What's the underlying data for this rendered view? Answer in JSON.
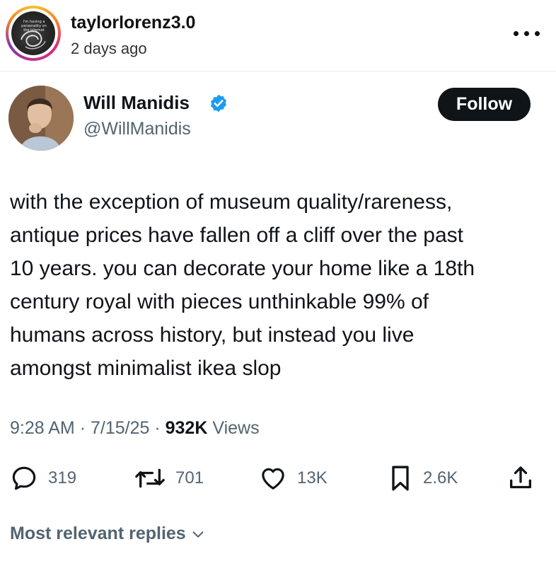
{
  "post_header": {
    "username": "taylorlorenz3.0",
    "timestamp": "2 days ago",
    "avatar_caption": "I'm having a personality on the internet",
    "menu_icon": "more-horizontal-icon"
  },
  "tweet": {
    "author_name": "Will Manidis",
    "author_handle": "@WillManidis",
    "follow_label": "Follow",
    "text": "with the exception of museum quality/rareness,\nantique prices have fallen off a cliff over the past\n10 years. you can decorate your home like a 18th\ncentury royal with pieces unthinkable 99% of\nhumans across history, but instead you live\namongst minimalist ikea slop",
    "time": "9:28 AM",
    "date": "7/15/25",
    "separator": "·",
    "views_count": "932K",
    "views_label": "Views"
  },
  "actions": {
    "replies": "319",
    "reposts": "701",
    "likes": "13K",
    "bookmarks": "2.6K"
  },
  "replies_section": {
    "label": "Most relevant replies"
  },
  "colors": {
    "text_primary": "#0f1419",
    "text_secondary": "#536471",
    "verified_blue": "#1d9bf0",
    "follow_bg": "#0f1419"
  }
}
